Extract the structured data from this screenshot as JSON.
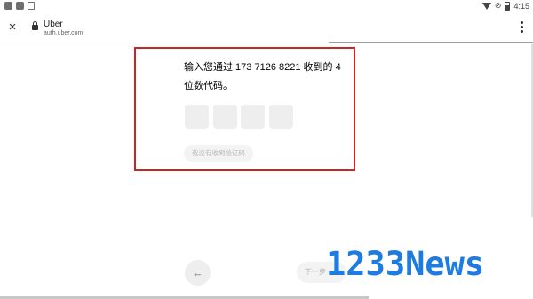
{
  "status_bar": {
    "time": "4:15",
    "icons": [
      "app-icon",
      "app-icon",
      "app-icon",
      "wifi-icon",
      "no-sim-icon",
      "battery-icon"
    ]
  },
  "browser": {
    "close_icon": "×",
    "site_title": "Uber",
    "site_url": "auth.uber.com",
    "menu_icon": "more-vert-icon"
  },
  "verify": {
    "prompt": "输入您通过 173 7126 8221 收到的 4 位数代码。",
    "code_boxes": [
      "",
      "",
      "",
      ""
    ],
    "resend_label": "我没有收到验证码"
  },
  "nav": {
    "back_icon": "←",
    "next_label": "下一步",
    "next_icon": "→"
  },
  "watermark": "1233News",
  "colors": {
    "highlight": "#c62828",
    "watermark": "#1e7be0"
  }
}
